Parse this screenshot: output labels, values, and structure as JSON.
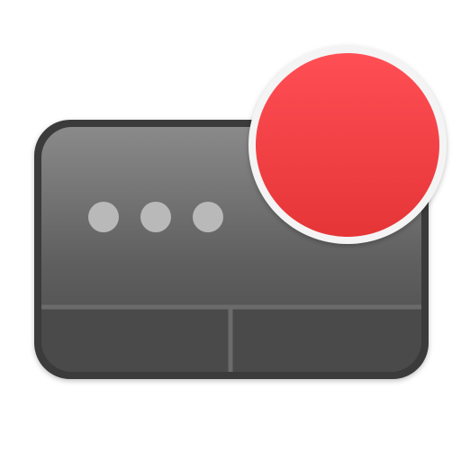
{
  "app_icon": {
    "icon_name": "trackpad-record-app-icon",
    "trackpad": {
      "icon_name": "trackpad-icon",
      "colors": {
        "frame": "#3a3a3a",
        "surface_top": "#8a8a8a",
        "surface_mid": "#5f5f5f",
        "surface_bottom": "#4a4a4a",
        "divider": "#6b6b6b",
        "dots": "#b9b9b9"
      },
      "dots_count": 3
    },
    "record_badge": {
      "icon_name": "record-dot-icon",
      "colors": {
        "ring": "#f4f4f4",
        "fill_top": "#ff4f55",
        "fill_bottom": "#e53537"
      }
    }
  }
}
